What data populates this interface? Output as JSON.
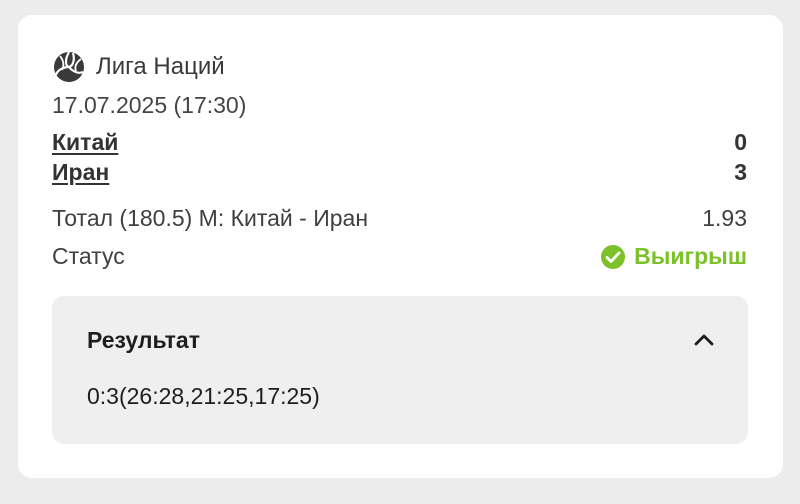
{
  "match": {
    "league": "Лига Наций",
    "league_icon": "volleyball-icon",
    "datetime": "17.07.2025 (17:30)",
    "team1": {
      "name": "Китай",
      "score": "0"
    },
    "team2": {
      "name": "Иран",
      "score": "3"
    }
  },
  "bet": {
    "market": "Тотал (180.5) М: Китай - Иран",
    "odds": "1.93",
    "status_label": "Статус",
    "status_value": "Выигрыш",
    "status_color": "#7cc12a",
    "status_icon": "check-circle-icon"
  },
  "result": {
    "title": "Результат",
    "value": "0:3(26:28,21:25,17:25)",
    "toggle_icon": "chevron-up-icon"
  }
}
